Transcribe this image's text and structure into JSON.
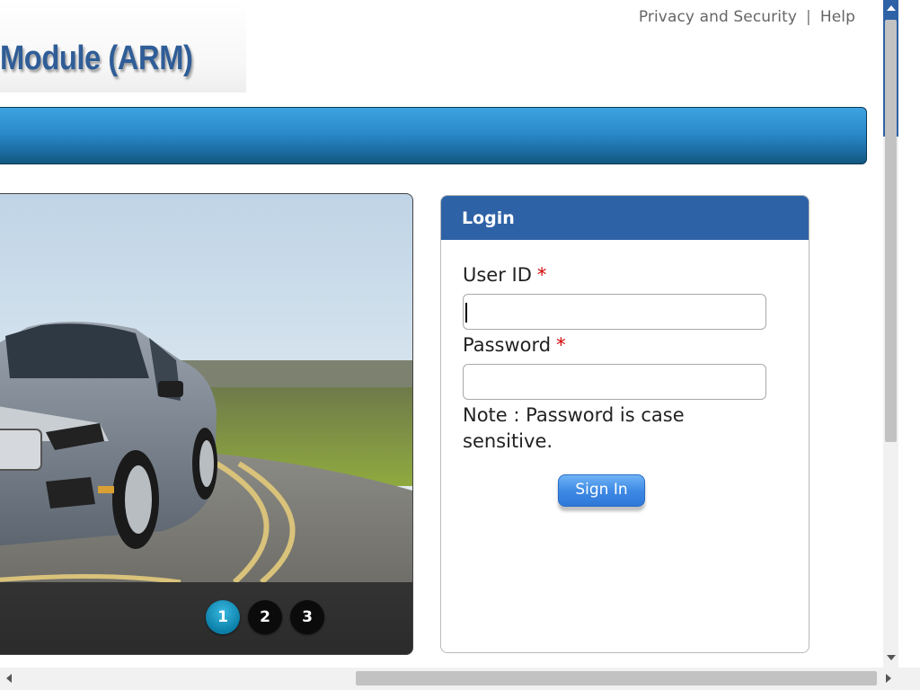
{
  "header": {
    "logo_text": "Module (ARM)",
    "links": [
      {
        "label": "Privacy and Security"
      },
      {
        "label": "Help"
      }
    ],
    "separator": "|"
  },
  "carousel": {
    "slides": [
      "1",
      "2",
      "3"
    ],
    "active_slide": 1
  },
  "login": {
    "title": "Login",
    "user_id_label": "User ID",
    "password_label": "Password",
    "required_mark": "*",
    "user_id_value": "",
    "password_value": "",
    "note": "Note : Password is case sensitive.",
    "signin_label": "Sign In"
  },
  "colors": {
    "brand_blue": "#2e62a6",
    "bar_blue": "#2a8acb",
    "required_red": "#d00000",
    "active_dot": "#1a9cc6"
  }
}
